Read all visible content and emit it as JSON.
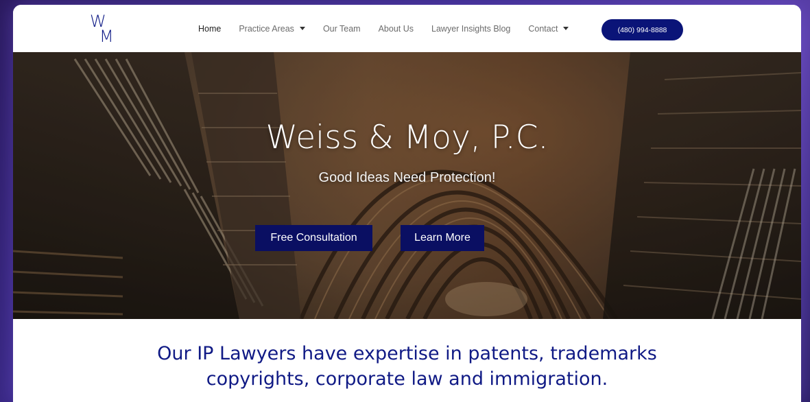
{
  "logo": {
    "top": "W",
    "bottom": "M"
  },
  "nav": {
    "items": [
      {
        "label": "Home",
        "active": true,
        "dropdown": false
      },
      {
        "label": "Practice Areas",
        "active": false,
        "dropdown": true
      },
      {
        "label": "Our Team",
        "active": false,
        "dropdown": false
      },
      {
        "label": "About Us",
        "active": false,
        "dropdown": false
      },
      {
        "label": "Lawyer Insights Blog",
        "active": false,
        "dropdown": false
      },
      {
        "label": "Contact",
        "active": false,
        "dropdown": true
      }
    ],
    "phone": "(480) 994-8888"
  },
  "hero": {
    "title": "Weiss & Moy, P.C.",
    "subtitle": "Good Ideas Need Protection!",
    "primary_button": "Free Consultation",
    "secondary_button": "Learn More"
  },
  "tagline": {
    "line1": "Our IP Lawyers have expertise in patents, trademarks",
    "line2": "copyrights, corporate law and immigration."
  },
  "colors": {
    "brand_navy": "#0a1478",
    "button_dark": "#0a0f62",
    "tagline_blue": "#101a85"
  }
}
